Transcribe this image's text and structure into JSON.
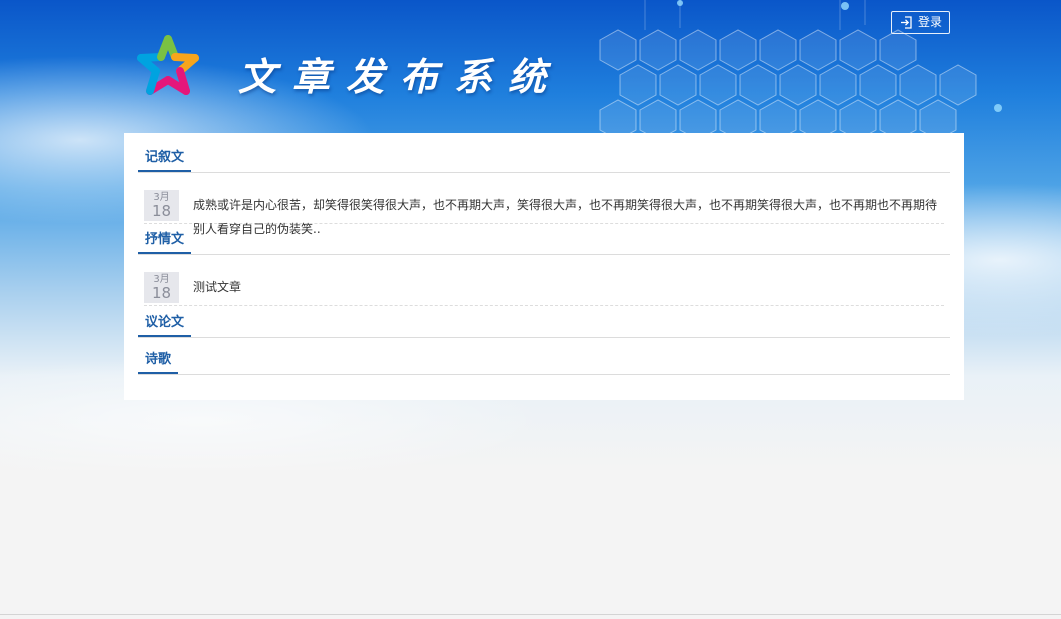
{
  "header": {
    "site_title": "文章发布系统",
    "login_label": "登录",
    "login_icon": "login-icon",
    "logo_icon": "star-logo-icon"
  },
  "sections": [
    {
      "title": "记叙文",
      "articles": [
        {
          "month": "3月",
          "day": "18",
          "text": "成熟或许是内心很苦，却笑得很笑得很大声，也不再期大声，笑得很大声，也不再期笑得很大声，也不再期笑得很大声，也不再期也不再期待别人看穿自己的伪装笑.."
        }
      ]
    },
    {
      "title": "抒情文",
      "articles": [
        {
          "month": "3月",
          "day": "18",
          "text": "测试文章"
        }
      ]
    },
    {
      "title": "议论文",
      "articles": []
    },
    {
      "title": "诗歌",
      "articles": []
    }
  ],
  "colors": {
    "accent": "#1f5fa6",
    "banner_top": "#0a56c9",
    "background": "#f4f4f4",
    "date_badge_bg": "#e6e7ec"
  }
}
